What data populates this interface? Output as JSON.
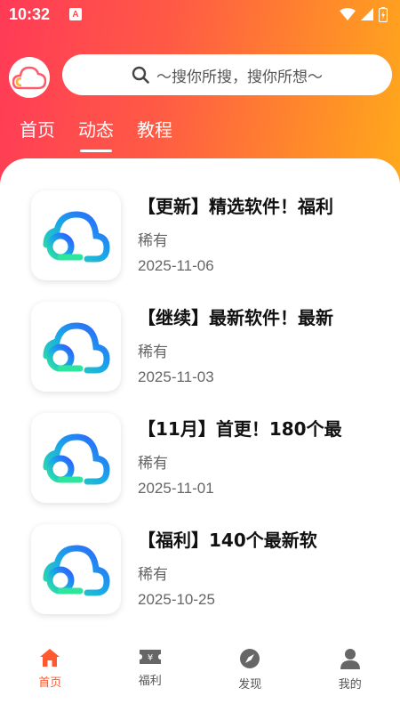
{
  "status_bar": {
    "time": "10:32",
    "notif_badge": "A"
  },
  "header": {
    "search_placeholder": "～搜你所搜，搜你所想～"
  },
  "tabs": [
    {
      "label": "首页",
      "active": false
    },
    {
      "label": "动态",
      "active": true
    },
    {
      "label": "教程",
      "active": false
    }
  ],
  "items": [
    {
      "title": "【更新】精选软件！福利",
      "author": "稀有",
      "date": "2025-11-06"
    },
    {
      "title": "【继续】最新软件！最新",
      "author": "稀有",
      "date": "2025-11-03"
    },
    {
      "title": "【11月】首更！180个最",
      "author": "稀有",
      "date": "2025-11-01"
    },
    {
      "title": "【福利】140个最新软",
      "author": "稀有",
      "date": "2025-10-25"
    }
  ],
  "bottom_nav": [
    {
      "label": "首页",
      "icon": "home-icon",
      "active": true
    },
    {
      "label": "福利",
      "icon": "ticket-icon",
      "active": false
    },
    {
      "label": "发现",
      "icon": "compass-icon",
      "active": false
    },
    {
      "label": "我的",
      "icon": "person-icon",
      "active": false
    }
  ],
  "colors": {
    "accent": "#ff5a2f",
    "gradient_start": "#ff3a57",
    "gradient_end": "#ffab1a"
  }
}
